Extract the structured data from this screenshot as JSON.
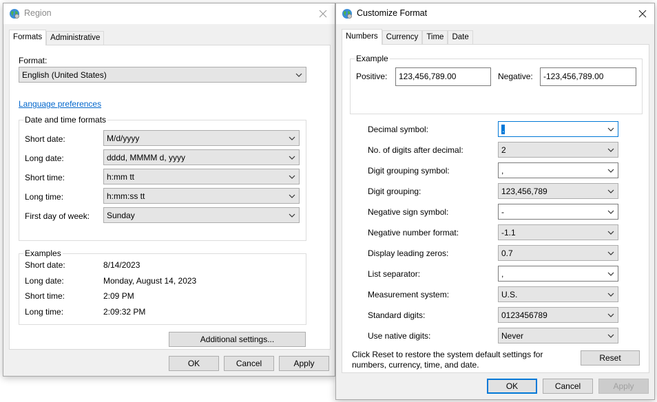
{
  "region": {
    "title": "Region",
    "tabs": [
      "Formats",
      "Administrative"
    ],
    "format_label": "Format:",
    "format_value": "English (United States)",
    "language_link": "Language preferences",
    "dt_group_title": "Date and time formats",
    "dt_rows": [
      {
        "label": "Short date:",
        "value": "M/d/yyyy"
      },
      {
        "label": "Long date:",
        "value": "dddd, MMMM d, yyyy"
      },
      {
        "label": "Short time:",
        "value": "h:mm tt"
      },
      {
        "label": "Long time:",
        "value": "h:mm:ss tt"
      },
      {
        "label": "First day of week:",
        "value": "Sunday"
      }
    ],
    "examples_title": "Examples",
    "examples": [
      {
        "label": "Short date:",
        "value": "8/14/2023"
      },
      {
        "label": "Long date:",
        "value": "Monday, August 14, 2023"
      },
      {
        "label": "Short time:",
        "value": "2:09 PM"
      },
      {
        "label": "Long time:",
        "value": "2:09:32 PM"
      }
    ],
    "additional_button": "Additional settings...",
    "ok": "OK",
    "cancel": "Cancel",
    "apply": "Apply"
  },
  "customize": {
    "title": "Customize Format",
    "tabs": [
      "Numbers",
      "Currency",
      "Time",
      "Date"
    ],
    "example_title": "Example",
    "positive_label": "Positive:",
    "positive_value": "123,456,789.00",
    "negative_label": "Negative:",
    "negative_value": "-123,456,789.00",
    "settings": [
      {
        "label": "Decimal symbol:",
        "value": "."
      },
      {
        "label": "No. of digits after decimal:",
        "value": "2"
      },
      {
        "label": "Digit grouping symbol:",
        "value": ","
      },
      {
        "label": "Digit grouping:",
        "value": "123,456,789"
      },
      {
        "label": "Negative sign symbol:",
        "value": "-"
      },
      {
        "label": "Negative number format:",
        "value": "-1.1"
      },
      {
        "label": "Display leading zeros:",
        "value": "0.7"
      },
      {
        "label": "List separator:",
        "value": ","
      },
      {
        "label": "Measurement system:",
        "value": "U.S."
      },
      {
        "label": "Standard digits:",
        "value": "0123456789"
      },
      {
        "label": "Use native digits:",
        "value": "Never"
      }
    ],
    "reset_note": "Click Reset to restore the system default settings for numbers, currency, time, and date.",
    "reset_button": "Reset",
    "ok": "OK",
    "cancel": "Cancel",
    "apply": "Apply"
  },
  "colors": {
    "accent": "#0078d7",
    "link": "#0066cc",
    "dialog_bg": "#f0f0f0"
  }
}
